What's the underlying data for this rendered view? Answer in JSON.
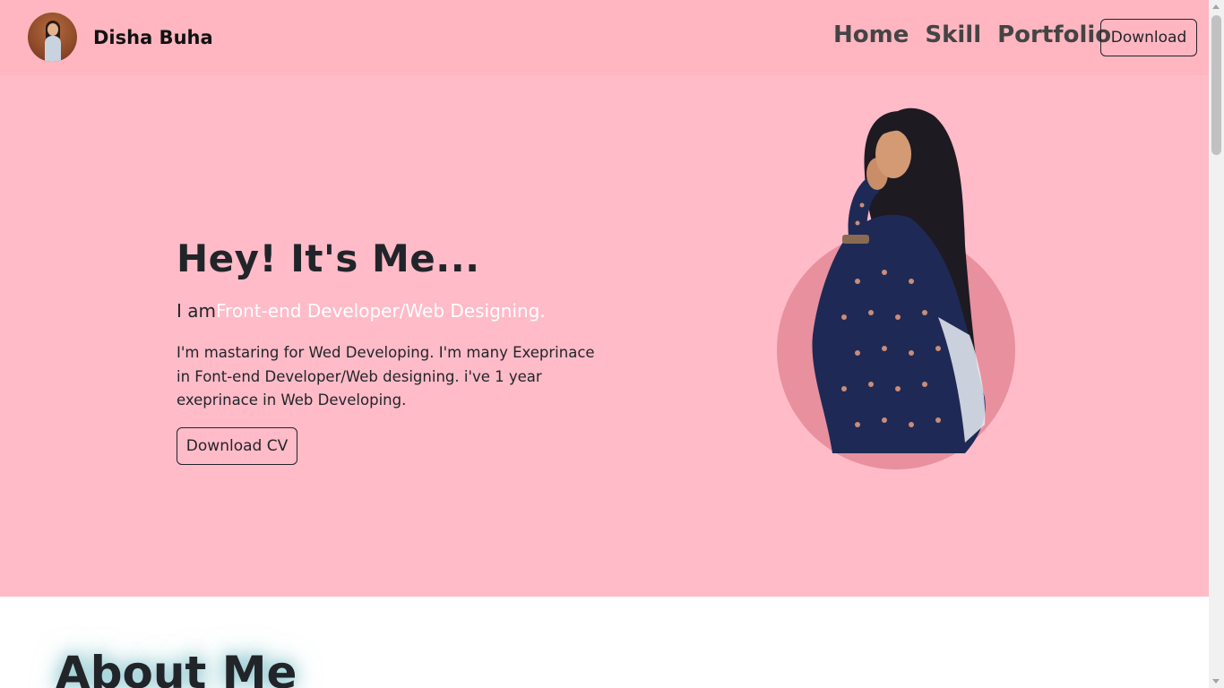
{
  "nav": {
    "brand": "Disha Buha",
    "links": [
      "Home",
      "Skill",
      "Portfolio"
    ],
    "download_label": "Download"
  },
  "hero": {
    "title": "Hey! It's Me...",
    "subtitle_prefix": "I am",
    "subtitle_role": "Front-end Developer/Web Designing.",
    "description": "I'm mastaring for Wed Developing. I'm many Exeprinace in Font-end Developer/Web designing. i've 1 year exeprinace in Web Developing.",
    "cta_label": "Download CV"
  },
  "about": {
    "title": "About Me"
  },
  "colors": {
    "navbar_bg": "#ffb6c1",
    "hero_bg": "#ffbbc8",
    "accent_circle": "#e8909e",
    "role_text": "#ffffff"
  }
}
